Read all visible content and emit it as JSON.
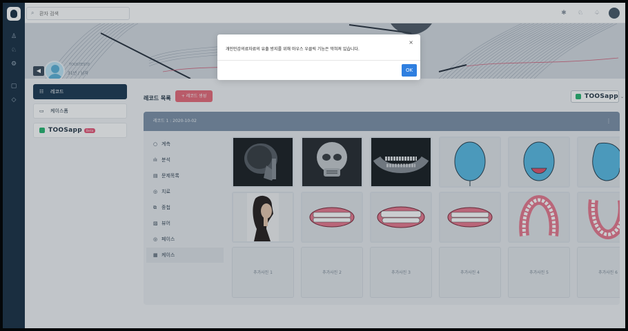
{
  "search": {
    "placeholder": "환자 검색"
  },
  "patient": {
    "name": "TOOSTESTD",
    "info": "31년 / 남자"
  },
  "menu": {
    "items": [
      {
        "label": "레코드"
      },
      {
        "label": "케이스폼"
      }
    ],
    "toosapp_label": "TOOSapp",
    "toosapp_badge": "Beta"
  },
  "records": {
    "title": "레코드 목록",
    "create_button": "+ 레코드 생성",
    "select_value": "TOOSapp"
  },
  "panel": {
    "header": "레코드 1 : 2020-10-02",
    "categories": [
      {
        "icon": "○",
        "label": "계측"
      },
      {
        "icon": "ılı",
        "label": "분석"
      },
      {
        "icon": "▤",
        "label": "문제목록"
      },
      {
        "icon": "◎",
        "label": "치료"
      },
      {
        "icon": "⧉",
        "label": "중첩"
      },
      {
        "icon": "▨",
        "label": "뷰어"
      },
      {
        "icon": "◎",
        "label": "페이스"
      },
      {
        "icon": "▦",
        "label": "케이스"
      }
    ],
    "add_photos": [
      "추가사진 1",
      "추가사진 2",
      "추가사진 3",
      "추가사진 4",
      "추가사진 5",
      "추가사진 6"
    ]
  },
  "modal": {
    "message": "개인민감의료자료의 유출 방지를 위해 마우스 우클릭 기능은 막혀져 있습니다.",
    "ok_label": "OK",
    "close_symbol": "×"
  },
  "colors": {
    "rail": "#1d3347",
    "accent_button": "#e86c7c",
    "ok_button": "#2f7fe0",
    "panel_header": "#7f93aa",
    "toosapp_green": "#2bb673"
  }
}
